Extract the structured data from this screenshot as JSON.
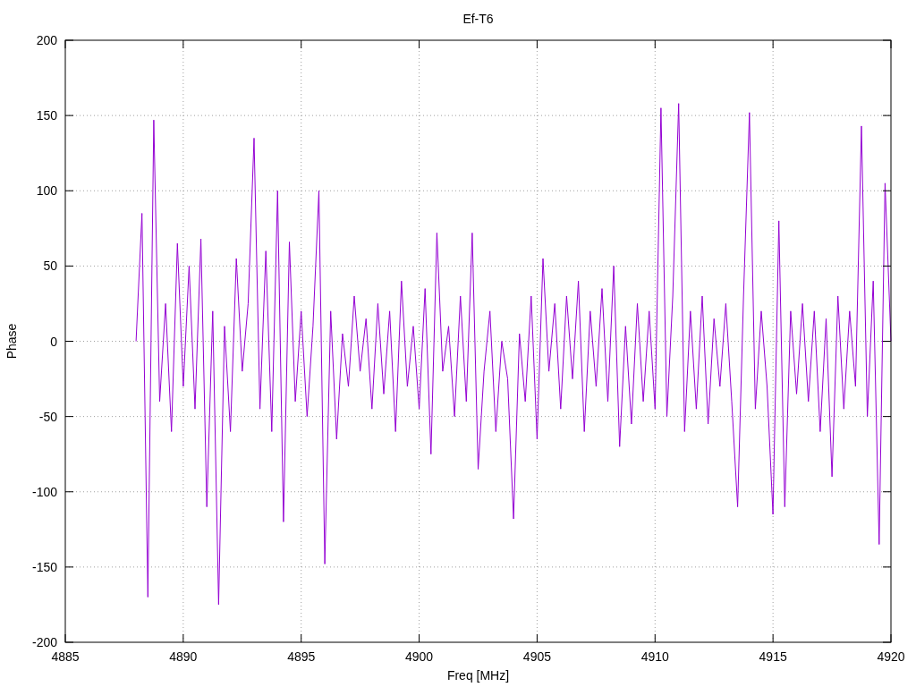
{
  "chart_data": {
    "type": "line",
    "title": "Ef-T6",
    "xlabel": "Freq [MHz]",
    "ylabel": "Phase",
    "x": [
      4888,
      4888.25,
      4888.5,
      4888.75,
      4889,
      4889.25,
      4889.5,
      4889.75,
      4890,
      4890.25,
      4890.5,
      4890.75,
      4891,
      4891.25,
      4891.5,
      4891.75,
      4892,
      4892.25,
      4892.5,
      4892.75,
      4893,
      4893.25,
      4893.5,
      4893.75,
      4894,
      4894.25,
      4894.5,
      4894.75,
      4895,
      4895.25,
      4895.5,
      4895.75,
      4896,
      4896.25,
      4896.5,
      4896.75,
      4897,
      4897.25,
      4897.5,
      4897.75,
      4898,
      4898.25,
      4898.5,
      4898.75,
      4899,
      4899.25,
      4899.5,
      4899.75,
      4900,
      4900.25,
      4900.5,
      4900.75,
      4901,
      4901.25,
      4901.5,
      4901.75,
      4902,
      4902.25,
      4902.5,
      4902.75,
      4903,
      4903.25,
      4903.5,
      4903.75,
      4904,
      4904.25,
      4904.5,
      4904.75,
      4905,
      4905.25,
      4905.5,
      4905.75,
      4906,
      4906.25,
      4906.5,
      4906.75,
      4907,
      4907.25,
      4907.5,
      4907.75,
      4908,
      4908.25,
      4908.5,
      4908.75,
      4909,
      4909.25,
      4909.5,
      4909.75,
      4910,
      4910.25,
      4910.5,
      4910.75,
      4911,
      4911.25,
      4911.5,
      4911.75,
      4912,
      4912.25,
      4912.5,
      4912.75,
      4913,
      4913.25,
      4913.5,
      4913.75,
      4914,
      4914.25,
      4914.5,
      4914.75,
      4915,
      4915.25,
      4915.5,
      4915.75,
      4916,
      4916.25,
      4916.5,
      4916.75,
      4917,
      4917.25,
      4917.5,
      4917.75,
      4918,
      4918.25,
      4918.5,
      4918.75,
      4919,
      4919.25,
      4919.5,
      4919.75,
      4920
    ],
    "series": [
      {
        "color": "#9400d3",
        "values": [
          0,
          85,
          -170,
          147,
          -40,
          25,
          -60,
          65,
          -30,
          50,
          -45,
          68,
          -110,
          20,
          -175,
          10,
          -60,
          55,
          -20,
          25,
          135,
          -45,
          60,
          -60,
          100,
          -120,
          66,
          -40,
          20,
          -50,
          10,
          100,
          -148,
          20,
          -65,
          5,
          -30,
          30,
          -20,
          15,
          -45,
          25,
          -35,
          20,
          -60,
          40,
          -30,
          10,
          -45,
          35,
          -75,
          72,
          -20,
          10,
          -50,
          30,
          -40,
          72,
          -85,
          -20,
          20,
          -60,
          0,
          -25,
          -118,
          5,
          -40,
          30,
          -65,
          55,
          -20,
          25,
          -45,
          30,
          -25,
          40,
          -60,
          20,
          -30,
          35,
          -40,
          50,
          -70,
          10,
          -55,
          25,
          -40,
          20,
          -45,
          155,
          -50,
          30,
          158,
          -60,
          20,
          -45,
          30,
          -55,
          15,
          -30,
          25,
          -40,
          -110,
          30,
          152,
          -45,
          20,
          -30,
          -115,
          80,
          -110,
          20,
          -35,
          25,
          -40,
          20,
          -60,
          15,
          -90,
          30,
          -45,
          20,
          -30,
          143,
          -50,
          40,
          -135,
          105,
          0
        ]
      }
    ],
    "grid": true,
    "xlim": [
      4885,
      4920
    ],
    "ylim": [
      -200,
      200
    ],
    "xticks": [
      4885,
      4890,
      4895,
      4900,
      4905,
      4910,
      4915,
      4920
    ],
    "yticks": [
      -200,
      -150,
      -100,
      -50,
      0,
      50,
      100,
      150,
      200
    ]
  }
}
